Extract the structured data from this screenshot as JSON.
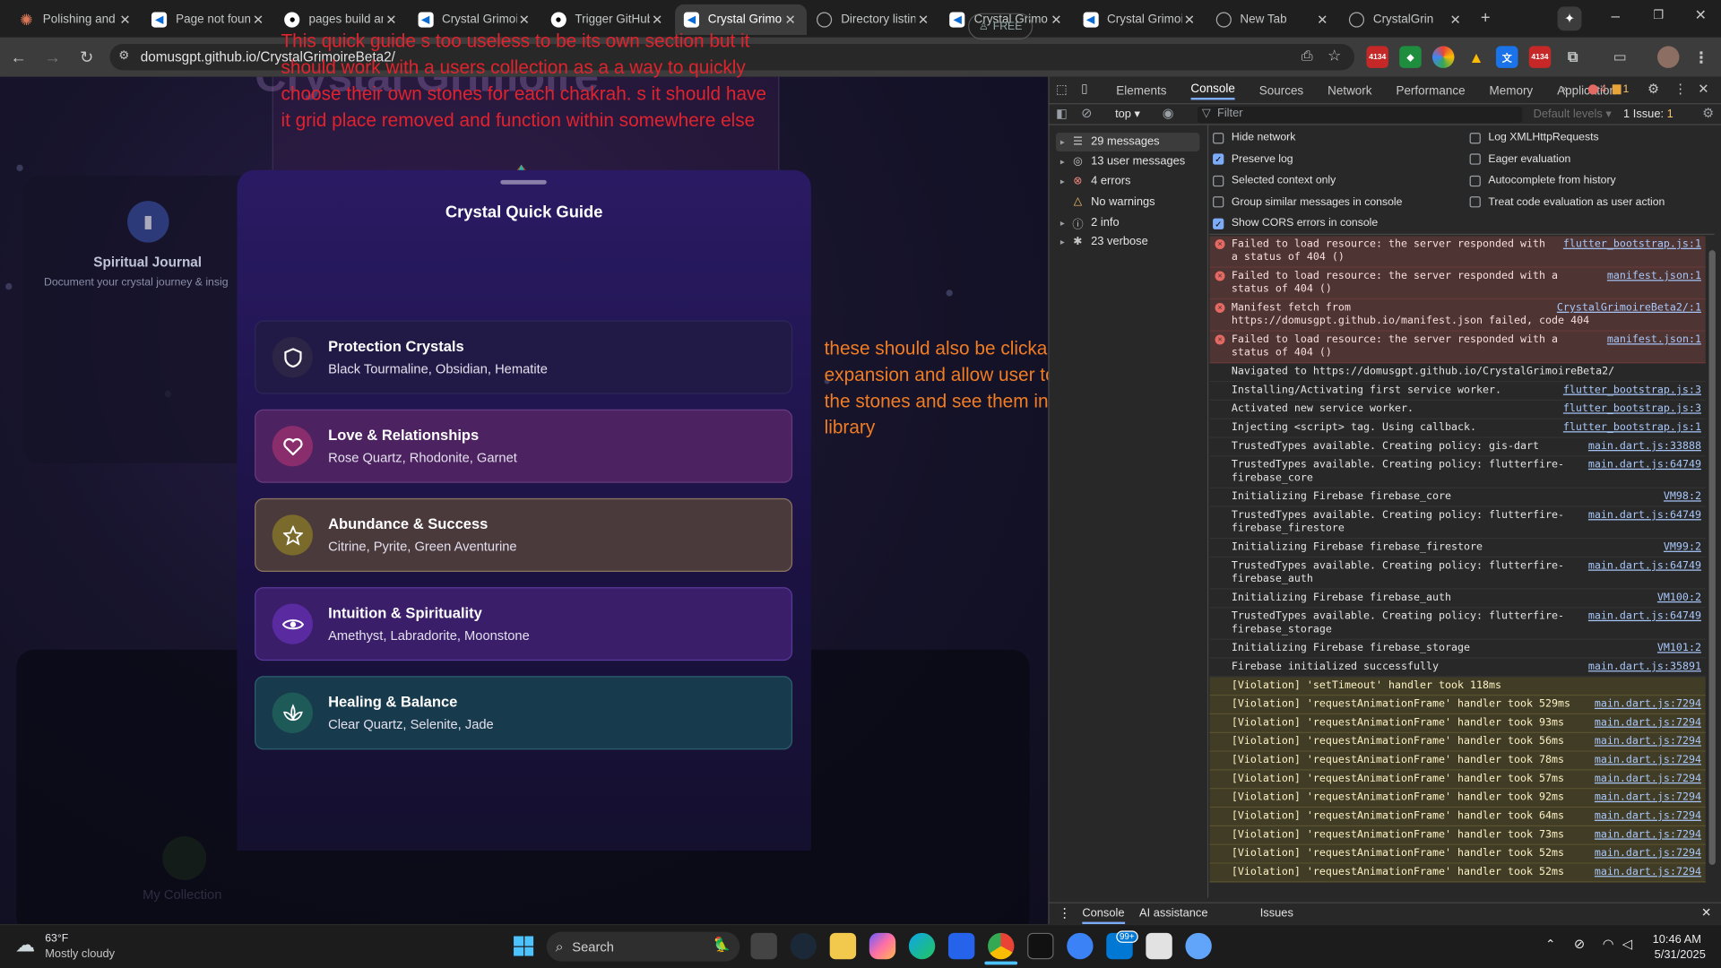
{
  "tabs": [
    {
      "title": "Polishing and I",
      "icon": "claude-icon"
    },
    {
      "title": "Page not foun",
      "icon": "flutter-icon"
    },
    {
      "title": "pages build an",
      "icon": "github-icon"
    },
    {
      "title": "Crystal Grimoi",
      "icon": "flutter-icon"
    },
    {
      "title": "Trigger GitHub",
      "icon": "github-icon"
    },
    {
      "title": "Crystal Grimoi",
      "icon": "flutter-icon",
      "active": true
    },
    {
      "title": "Directory listin",
      "icon": "globe-icon"
    },
    {
      "title": "Crystal Grimoi",
      "icon": "flutter-icon"
    },
    {
      "title": "Crystal Grimoi",
      "icon": "flutter-icon"
    },
    {
      "title": "New Tab",
      "icon": "chrome-icon"
    },
    {
      "title": "CrystalGrin",
      "icon": "globe-icon"
    }
  ],
  "address": {
    "url": "domusgpt.github.io/CrystalGrimoireBeta2/"
  },
  "extensions": {
    "badge1": "4134",
    "badge2": "4134"
  },
  "page": {
    "header_title_fragment": "Crystal Grimoire",
    "free_label": "FREE",
    "journal": {
      "title": "Spiritual Journal",
      "subtitle": "Document your crystal journey & insig"
    },
    "collection_label": "My Collection",
    "note_red": "This quick guide s too useless to be its own section but it should work with a users collection as a a way to quickly choose their own stones for each chakrah. s it should have it grid place removed and function within somewhere else",
    "note_orange": "these should also be clickable for expansion and allow user to click the stones and see them in the library"
  },
  "guide": {
    "title": "Crystal Quick Guide",
    "items": [
      {
        "title": "Protection Crystals",
        "stones": "Black Tourmaline, Obsidian, Hematite",
        "icon": "shield-icon",
        "bg": "#221a46",
        "iconbg": "#2c2546"
      },
      {
        "title": "Love & Relationships",
        "stones": "Rose Quartz, Rhodonite, Garnet",
        "icon": "heart-icon",
        "bg": "#4c2260",
        "iconbg": "#8a2d6c"
      },
      {
        "title": "Abundance & Success",
        "stones": "Citrine, Pyrite, Green Aventurine",
        "icon": "star-icon",
        "bg": "#4a3a3c",
        "iconbg": "#7a6a2c"
      },
      {
        "title": "Intuition & Spirituality",
        "stones": "Amethyst, Labradorite, Moonstone",
        "icon": "eye-icon",
        "bg": "#3a1e6a",
        "iconbg": "#5a2aa0"
      },
      {
        "title": "Healing & Balance",
        "stones": "Clear Quartz, Selenite, Jade",
        "icon": "spa-icon",
        "bg": "#173a4c",
        "iconbg": "#1e5a58"
      }
    ]
  },
  "devtools": {
    "tabs": [
      "Elements",
      "Console",
      "Sources",
      "Network",
      "Performance",
      "Memory",
      "Application"
    ],
    "selected_tab": "Console",
    "error_count": "4",
    "warn_count": "1",
    "context": "top",
    "filter_placeholder": "Filter",
    "levels": "Default levels",
    "issues": "1 Issue:",
    "issues_count": "1",
    "sidebar": [
      {
        "label": "29 messages",
        "icon": "list-icon"
      },
      {
        "label": "13 user messages",
        "icon": "user-icon"
      },
      {
        "label": "4 errors",
        "icon": "error-icon"
      },
      {
        "label": "No warnings",
        "icon": "warning-icon"
      },
      {
        "label": "2 info",
        "icon": "info-icon"
      },
      {
        "label": "23 verbose",
        "icon": "verbose-icon"
      }
    ],
    "settings_left": [
      {
        "label": "Hide network",
        "checked": false
      },
      {
        "label": "Preserve log",
        "checked": true
      },
      {
        "label": "Selected context only",
        "checked": false
      },
      {
        "label": "Group similar messages in console",
        "checked": false
      },
      {
        "label": "Show CORS errors in console",
        "checked": true
      }
    ],
    "settings_right": [
      {
        "label": "Log XMLHttpRequests",
        "checked": false
      },
      {
        "label": "Eager evaluation",
        "checked": false
      },
      {
        "label": "Autocomplete from history",
        "checked": false
      },
      {
        "label": "Treat code evaluation as user action",
        "checked": false
      }
    ],
    "logs": [
      {
        "type": "err",
        "text": "Failed to load resource: the server responded with a status of 404 ()",
        "src": "flutter_bootstrap.js:1"
      },
      {
        "type": "err",
        "text": "Failed to load resource: the server responded with a status of 404 ()",
        "src": "manifest.json:1"
      },
      {
        "type": "err",
        "text": "Manifest fetch from https://domusgpt.github.io/manifest.json failed, code 404",
        "src": "CrystalGrimoireBeta2/:1"
      },
      {
        "type": "err",
        "text": "Failed to load resource: the server responded with a status of 404 ()",
        "src": "manifest.json:1"
      },
      {
        "type": "log",
        "text": "Navigated to https://domusgpt.github.io/CrystalGrimoireBeta2/",
        "src": ""
      },
      {
        "type": "log",
        "text": "Installing/Activating first service worker.",
        "src": "flutter_bootstrap.js:3"
      },
      {
        "type": "log",
        "text": "Activated new service worker.",
        "src": "flutter_bootstrap.js:3"
      },
      {
        "type": "log",
        "text": "Injecting <script> tag. Using callback.",
        "src": "flutter_bootstrap.js:1"
      },
      {
        "type": "log",
        "text": "TrustedTypes available. Creating policy: gis-dart",
        "src": "main.dart.js:33888"
      },
      {
        "type": "log",
        "text": "TrustedTypes available. Creating policy: flutterfire-firebase_core",
        "src": "main.dart.js:64749"
      },
      {
        "type": "log",
        "text": "Initializing Firebase firebase_core",
        "src": "VM98:2"
      },
      {
        "type": "log",
        "text": "TrustedTypes available. Creating policy: flutterfire-firebase_firestore",
        "src": "main.dart.js:64749"
      },
      {
        "type": "log",
        "text": "Initializing Firebase firebase_firestore",
        "src": "VM99:2"
      },
      {
        "type": "log",
        "text": "TrustedTypes available. Creating policy: flutterfire-firebase_auth",
        "src": "main.dart.js:64749"
      },
      {
        "type": "log",
        "text": "Initializing Firebase firebase_auth",
        "src": "VM100:2"
      },
      {
        "type": "log",
        "text": "TrustedTypes available. Creating policy: flutterfire-firebase_storage",
        "src": "main.dart.js:64749"
      },
      {
        "type": "log",
        "text": "Initializing Firebase firebase_storage",
        "src": "VM101:2"
      },
      {
        "type": "log",
        "text": "Firebase initialized successfully",
        "src": "main.dart.js:35891"
      },
      {
        "type": "warn",
        "text": "[Violation] 'setTimeout' handler took 118ms",
        "src": ""
      },
      {
        "type": "warn",
        "text": "[Violation] 'requestAnimationFrame' handler took 529ms",
        "src": "main.dart.js:7294"
      },
      {
        "type": "warn",
        "text": "[Violation] 'requestAnimationFrame' handler took 93ms",
        "src": "main.dart.js:7294"
      },
      {
        "type": "warn",
        "text": "[Violation] 'requestAnimationFrame' handler took 56ms",
        "src": "main.dart.js:7294"
      },
      {
        "type": "warn",
        "text": "[Violation] 'requestAnimationFrame' handler took 78ms",
        "src": "main.dart.js:7294"
      },
      {
        "type": "warn",
        "text": "[Violation] 'requestAnimationFrame' handler took 57ms",
        "src": "main.dart.js:7294"
      },
      {
        "type": "warn",
        "text": "[Violation] 'requestAnimationFrame' handler took 92ms",
        "src": "main.dart.js:7294"
      },
      {
        "type": "warn",
        "text": "[Violation] 'requestAnimationFrame' handler took 64ms",
        "src": "main.dart.js:7294"
      },
      {
        "type": "warn",
        "text": "[Violation] 'requestAnimationFrame' handler took 73ms",
        "src": "main.dart.js:7294"
      },
      {
        "type": "warn",
        "text": "[Violation] 'requestAnimationFrame' handler took 52ms",
        "src": "main.dart.js:7294"
      },
      {
        "type": "warn",
        "text": "[Violation] 'requestAnimationFrame' handler took 52ms",
        "src": "main.dart.js:7294"
      }
    ],
    "drawer_tabs": [
      "Console",
      "AI assistance",
      "Issues"
    ]
  },
  "taskbar": {
    "weather_temp": "63°F",
    "weather_desc": "Mostly cloudy",
    "search_label": "Search",
    "mail_badge": "99+",
    "time": "10:46 AM",
    "date": "5/31/2025"
  }
}
